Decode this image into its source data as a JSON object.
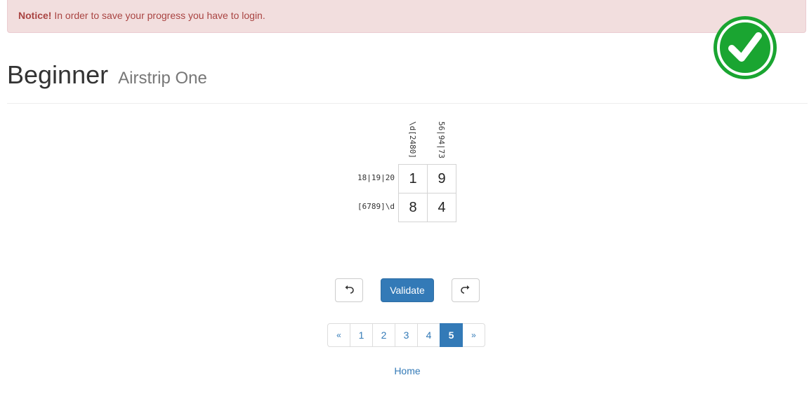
{
  "alert": {
    "label": "Notice!",
    "message": "In order to save your progress you have to login."
  },
  "status": {
    "icon": "check-circle-icon",
    "color": "#1aa531"
  },
  "header": {
    "title": "Beginner",
    "subtitle": "Airstrip One"
  },
  "puzzle": {
    "column_clues": [
      "\\d[2480]",
      "56|94|73"
    ],
    "row_clues": [
      "18|19|20",
      "[6789]\\d"
    ],
    "cells": [
      [
        "1",
        "9"
      ],
      [
        "8",
        "4"
      ]
    ]
  },
  "actions": {
    "undo_icon": "undo-icon",
    "validate_label": "Validate",
    "redo_icon": "redo-icon"
  },
  "pagination": {
    "prev": "«",
    "pages": [
      "1",
      "2",
      "3",
      "4",
      "5"
    ],
    "current": "5",
    "next": "»"
  },
  "footer": {
    "home_label": "Home"
  },
  "colors": {
    "primary": "#337ab7",
    "alert_bg": "#f2dede",
    "alert_text": "#a94442"
  }
}
